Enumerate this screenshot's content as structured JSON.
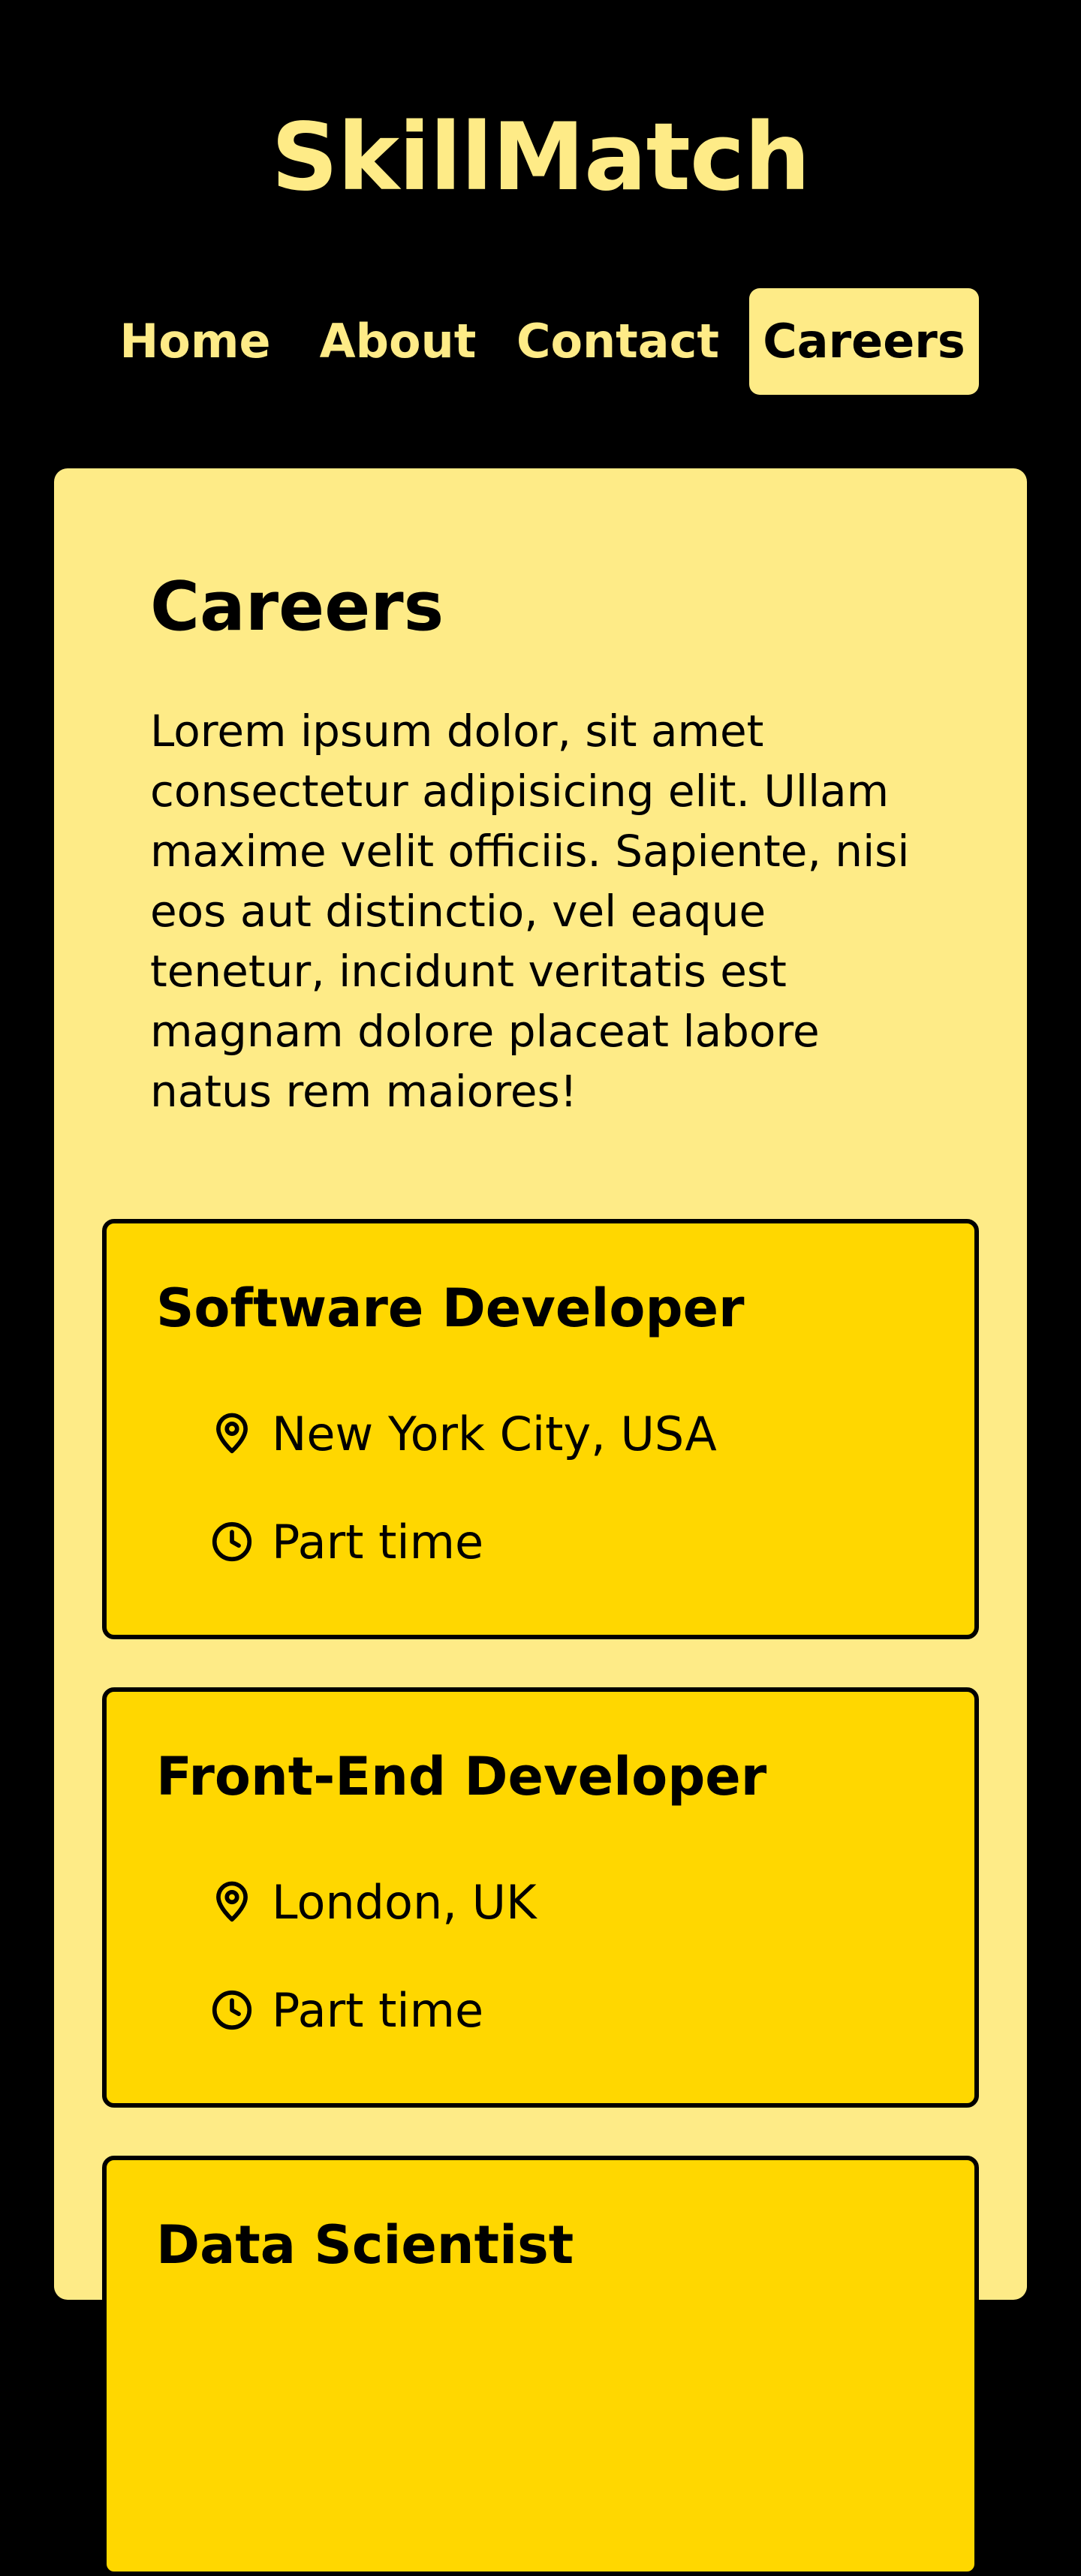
{
  "header": {
    "brand": "SkillMatch"
  },
  "nav": {
    "items": [
      {
        "label": "Home",
        "active": false
      },
      {
        "label": "About",
        "active": false
      },
      {
        "label": "Contact",
        "active": false
      },
      {
        "label": "Careers",
        "active": true
      }
    ]
  },
  "careers": {
    "title": "Careers",
    "description": "Lorem ipsum dolor, sit amet consectetur adipisicing elit. Ullam maxime velit officiis. Sapiente, nisi eos aut distinctio, vel eaque tenetur, incidunt veritatis est magnam dolore placeat labore natus rem maiores!",
    "jobs": [
      {
        "title": "Software Developer",
        "location": "New York City, USA",
        "type": "Part time"
      },
      {
        "title": "Front-End Developer",
        "location": "London, UK",
        "type": "Part time"
      },
      {
        "title": "Data Scientist"
      }
    ]
  },
  "icons": {
    "location": "map-pin-icon",
    "type": "clock-icon"
  },
  "colors": {
    "background": "#000000",
    "accent_light": "#FEEB87",
    "card_yellow": "#FFD700",
    "text": "#000000"
  }
}
